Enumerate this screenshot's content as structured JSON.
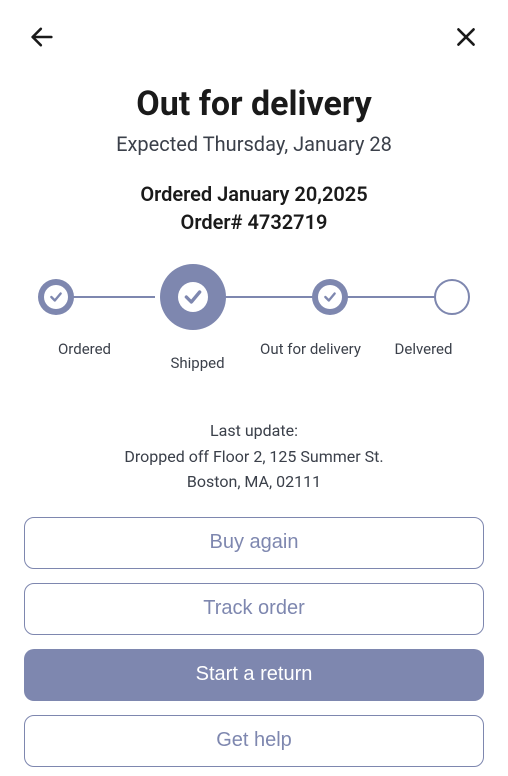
{
  "header": {
    "title": "Out for delivery",
    "subtitle": "Expected Thursday, January 28"
  },
  "order": {
    "date_line": "Ordered January 20,2025",
    "id_line": "Order# 4732719"
  },
  "progress": {
    "steps": [
      {
        "label": "Ordered"
      },
      {
        "label": "Shipped"
      },
      {
        "label": "Out for delivery"
      },
      {
        "label": "Delvered"
      }
    ]
  },
  "last_update": {
    "label": "Last update:",
    "line1": "Dropped off Floor 2, 125 Summer St.",
    "line2": "Boston, MA, 02111"
  },
  "actions": {
    "buy_again": "Buy again",
    "track_order": "Track order",
    "start_return": "Start a return",
    "get_help": "Get help"
  }
}
